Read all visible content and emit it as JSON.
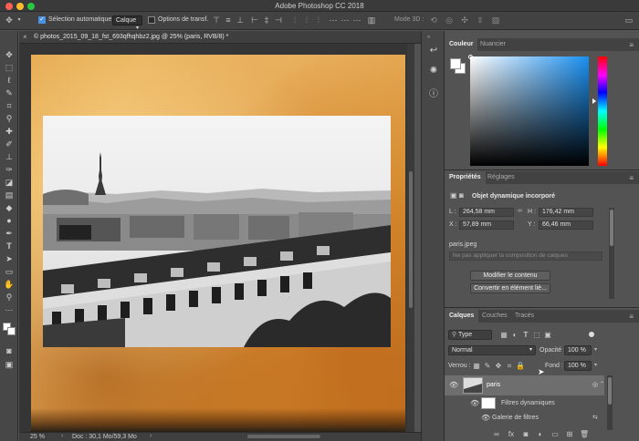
{
  "app": {
    "title": "Adobe Photoshop CC 2018"
  },
  "options_bar": {
    "auto_select_label": "Sélection automatique :",
    "auto_select_checked": true,
    "auto_select_target": "Calque",
    "transform_controls_label": "Options de transf.",
    "transform_controls_checked": false,
    "mode_3d_label": "Mode 3D :"
  },
  "document": {
    "tab_title": "© photos_2015_09_18_fst_693qfhqhbz2.jpg @ 25% (paris, RVB/8) *",
    "zoom": "25 %",
    "doc_size": "Doc : 30,1 Mo/59,3 Mo"
  },
  "color_panel": {
    "tabs": [
      "Couleur",
      "Nuancier"
    ],
    "active_tab": "Couleur",
    "hue_color": "#1a8ff0"
  },
  "properties_panel": {
    "tabs": [
      "Propriétés",
      "Réglages"
    ],
    "active_tab": "Propriétés",
    "object_type": "Objet dynamique incorporé",
    "L_label": "L :",
    "L_value": "264,58 mm",
    "H_label": "H :",
    "H_value": "176,42 mm",
    "X_label": "X :",
    "X_value": "57,89 mm",
    "Y_label": "Y :",
    "Y_value": "66,46 mm",
    "source_file": "paris.jpeg",
    "composition_placeholder": "Ne pas appliquer la composition de calques",
    "edit_contents_label": "Modifier le contenu",
    "convert_label": "Convertir en élément lié..."
  },
  "layers_panel": {
    "tabs": [
      "Calques",
      "Couches",
      "Tracés"
    ],
    "active_tab": "Calques",
    "filter_type": "Type",
    "blend_mode": "Normal",
    "opacity_label": "Opacité :",
    "opacity_value": "100 %",
    "lock_label": "Verrou :",
    "fill_label": "Fond :",
    "fill_value": "100 %",
    "layers": [
      {
        "name": "paris",
        "selected": true
      },
      {
        "name": "Filtres dynamiques",
        "selected": false
      },
      {
        "name": "Galerie de filtres",
        "selected": false
      }
    ]
  }
}
